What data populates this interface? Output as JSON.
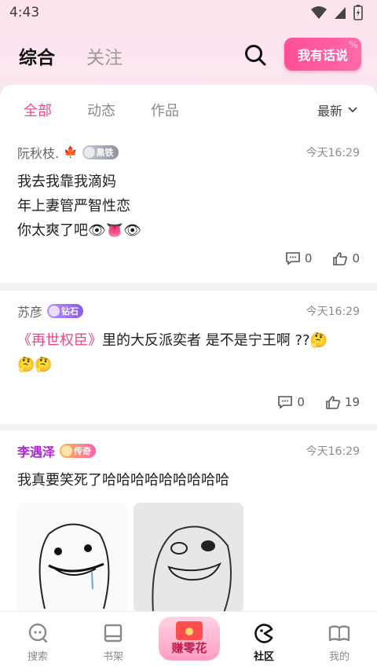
{
  "status": {
    "time": "4:43"
  },
  "header": {
    "tabs": [
      "综合",
      "关注"
    ],
    "speak_button": "我有话说"
  },
  "filters": {
    "tabs": [
      "全部",
      "动态",
      "作品"
    ],
    "sort": "最新"
  },
  "posts": [
    {
      "user": "阮秋枝.",
      "badge": "黑铁",
      "time": "今天16:29",
      "lines": [
        "我去我靠我滴妈",
        "年上妻管严智性恋",
        "你太爽了吧"
      ],
      "emoji_tail": "👁👅👁",
      "comments": "0",
      "likes": "0"
    },
    {
      "user": "苏彦",
      "badge": "钻石",
      "time": "今天16:29",
      "book": "《再世权臣》",
      "text": "里的大反派奕者 是不是宁王啊 ??",
      "emoji": "🤔",
      "emoji_line2": "🤔🤔",
      "comments": "0",
      "likes": "19"
    },
    {
      "user": "李遇泽",
      "badge": "传奇",
      "time": "今天16:29",
      "text": "我真要笑死了哈哈哈哈哈哈哈哈哈"
    }
  ],
  "bottom_nav": {
    "items": [
      "搜索",
      "书架",
      "赚零花",
      "社区",
      "我的"
    ]
  },
  "colors": {
    "accent": "#f0468c",
    "vip_name": "#b026d8"
  }
}
